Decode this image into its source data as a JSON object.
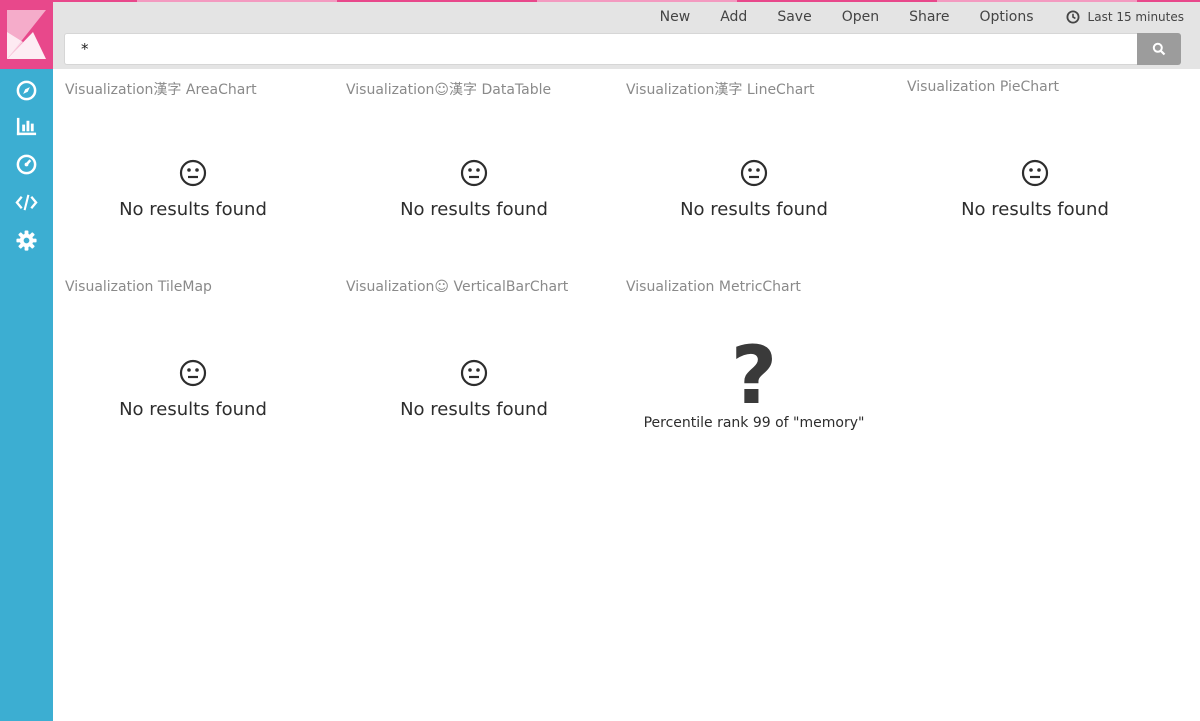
{
  "colors": {
    "sidebar": "#3caed2",
    "logo": "#e8488b",
    "topbar": "#e4e4e4",
    "accent_pink": "#e8488b"
  },
  "sidebar": {
    "logo_icon": "kibana-logo-icon",
    "items": [
      {
        "icon": "compass-icon",
        "name": "discover"
      },
      {
        "icon": "bar-chart-icon",
        "name": "visualize"
      },
      {
        "icon": "dashboard-gauge-icon",
        "name": "dashboard"
      },
      {
        "icon": "code-icon",
        "name": "dev-tools"
      },
      {
        "icon": "gear-icon",
        "name": "management"
      }
    ]
  },
  "toolbar": {
    "new_label": "New",
    "add_label": "Add",
    "save_label": "Save",
    "open_label": "Open",
    "share_label": "Share",
    "options_label": "Options",
    "time_icon": "clock-icon",
    "time_label": "Last 15 minutes"
  },
  "query": {
    "value": "*",
    "search_icon": "search-icon"
  },
  "panels": [
    {
      "title": "Visualization漢字 AreaChart",
      "message": "No results found",
      "icon": "neutral-face-icon"
    },
    {
      "title": "Visualization☺漢字 DataTable",
      "message": "No results found",
      "icon": "neutral-face-icon"
    },
    {
      "title": "Visualization漢字 LineChart",
      "message": "No results found",
      "icon": "neutral-face-icon"
    },
    {
      "title": "Visualization PieChart",
      "message": "No results found",
      "icon": "neutral-face-icon"
    },
    {
      "title": "Visualization TileMap",
      "message": "No results found",
      "icon": "neutral-face-icon"
    },
    {
      "title": "Visualization☺ VerticalBarChart",
      "message": "No results found",
      "icon": "neutral-face-icon"
    },
    {
      "title": "Visualization MetricChart",
      "metric_value": "?",
      "metric_label": "Percentile rank 99 of \"memory\""
    }
  ]
}
